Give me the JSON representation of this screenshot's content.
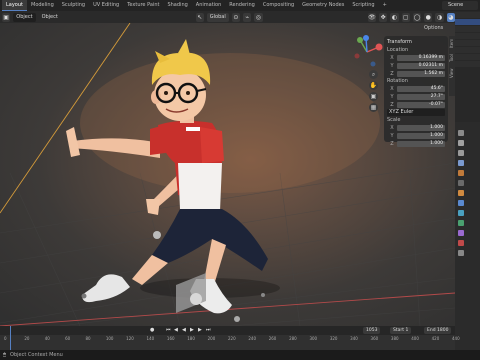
{
  "topbar": {
    "workspaces": [
      "Layout",
      "Modeling",
      "Sculpting",
      "UV Editing",
      "Texture Paint",
      "Shading",
      "Animation",
      "Rendering",
      "Compositing",
      "Geometry Nodes",
      "Scripting",
      "+"
    ],
    "active_index": 0,
    "scene": "Scene"
  },
  "header": {
    "mode": "Object",
    "object_menu": "Object",
    "orientation": "Global",
    "options": "Options"
  },
  "npanel": {
    "title": "Transform",
    "location_label": "Location",
    "location": [
      "0.16399 m",
      "0.02311 m",
      "1.562 m"
    ],
    "rotation_label": "Rotation",
    "rotation": [
      "45.6°",
      "27.7°",
      "-0.07°"
    ],
    "rotation_mode": "XYZ Euler",
    "scale_label": "Scale",
    "scale": [
      "1.000",
      "1.000",
      "1.000"
    ],
    "axes": [
      "X",
      "Y",
      "Z"
    ]
  },
  "tabs": [
    "Item",
    "Tool",
    "View"
  ],
  "timeline": {
    "ticks": [
      "0",
      "20",
      "40",
      "60",
      "80",
      "100",
      "120",
      "140",
      "160",
      "180",
      "200",
      "220",
      "240",
      "260",
      "280",
      "300",
      "320",
      "340",
      "360",
      "380",
      "400",
      "420",
      "440"
    ],
    "current_frame": "1053",
    "start_label": "Start",
    "start_value": "1",
    "end_label": "End",
    "end_value": "1800"
  },
  "status": {
    "text": "Object Context Menu"
  },
  "colors": {
    "accent": "#5680c2",
    "shirt_red": "#c8302c",
    "pants": "#1d2438",
    "hair": "#f0c84a"
  }
}
